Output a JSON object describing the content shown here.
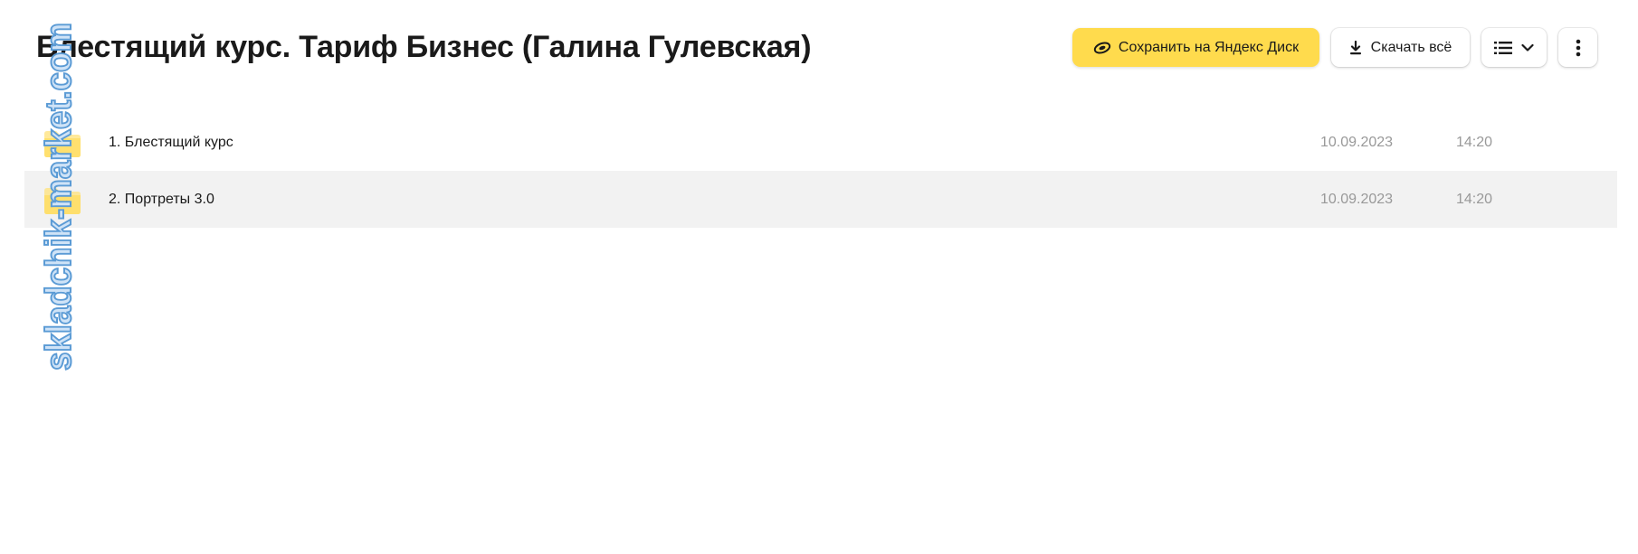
{
  "header": {
    "title": "Блестящий курс. Тариф Бизнес (Галина Гулевская)"
  },
  "toolbar": {
    "save_label": "Сохранить на Яндекс Диск",
    "save_icon": "yandex-disk-icon",
    "download_label": "Скачать всё",
    "download_icon": "download-icon",
    "view_icon": "list-view-icon",
    "more_icon": "more-vertical-icon",
    "accent_color": "#ffdb4d"
  },
  "files": [
    {
      "name": "1. Блестящий курс",
      "date": "10.09.2023",
      "time": "14:20",
      "icon": "folder-icon"
    },
    {
      "name": "2. Портреты 3.0",
      "date": "10.09.2023",
      "time": "14:20",
      "icon": "folder-icon"
    }
  ],
  "watermark": {
    "text": "skladchik-market.com"
  }
}
